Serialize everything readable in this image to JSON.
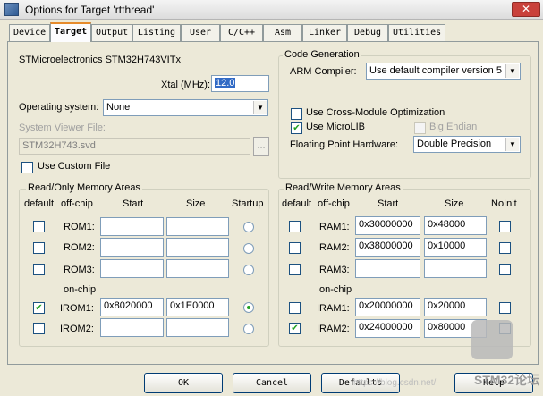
{
  "window": {
    "title": "Options for Target 'rtthread'",
    "close_label": "✕"
  },
  "tabs": [
    {
      "label": "Device"
    },
    {
      "label": "Target"
    },
    {
      "label": "Output"
    },
    {
      "label": "Listing"
    },
    {
      "label": "User"
    },
    {
      "label": "C/C++"
    },
    {
      "label": "Asm"
    },
    {
      "label": "Linker"
    },
    {
      "label": "Debug"
    },
    {
      "label": "Utilities"
    }
  ],
  "active_tab": "Target",
  "device": {
    "name": "STMicroelectronics STM32H743VITx",
    "xtal_label": "Xtal (MHz):",
    "xtal_value": "12.0"
  },
  "os": {
    "label": "Operating system:",
    "value": "None"
  },
  "svd": {
    "label": "System Viewer File:",
    "value": "STM32H743.svd",
    "browse": "..."
  },
  "custom_file": {
    "label": "Use Custom File",
    "checked": false
  },
  "code_gen": {
    "legend": "Code Generation",
    "compiler_label": "ARM Compiler:",
    "compiler_value": "Use default compiler version 5",
    "cross_module": {
      "label": "Use Cross-Module Optimization",
      "checked": false
    },
    "microlib": {
      "label": "Use MicroLIB",
      "checked": true
    },
    "big_endian": {
      "label": "Big Endian",
      "checked": false,
      "enabled": false
    },
    "fpu_label": "Floating Point Hardware:",
    "fpu_value": "Double Precision"
  },
  "ro_memory": {
    "legend": "Read/Only Memory Areas",
    "headers": {
      "default": "default",
      "offchip": "off-chip",
      "start": "Start",
      "size": "Size",
      "startup": "Startup"
    },
    "onchip_label": "on-chip",
    "rows": [
      {
        "name": "ROM1:",
        "default": false,
        "start": "",
        "size": "",
        "startup": false
      },
      {
        "name": "ROM2:",
        "default": false,
        "start": "",
        "size": "",
        "startup": false
      },
      {
        "name": "ROM3:",
        "default": false,
        "start": "",
        "size": "",
        "startup": false
      },
      {
        "name": "IROM1:",
        "default": true,
        "start": "0x8020000",
        "size": "0x1E0000",
        "startup": true
      },
      {
        "name": "IROM2:",
        "default": false,
        "start": "",
        "size": "",
        "startup": false
      }
    ]
  },
  "rw_memory": {
    "legend": "Read/Write Memory Areas",
    "headers": {
      "default": "default",
      "offchip": "off-chip",
      "start": "Start",
      "size": "Size",
      "noinit": "NoInit"
    },
    "onchip_label": "on-chip",
    "rows": [
      {
        "name": "RAM1:",
        "default": false,
        "start": "0x30000000",
        "size": "0x48000",
        "noinit": false
      },
      {
        "name": "RAM2:",
        "default": false,
        "start": "0x38000000",
        "size": "0x10000",
        "noinit": false
      },
      {
        "name": "RAM3:",
        "default": false,
        "start": "",
        "size": "",
        "noinit": false
      },
      {
        "name": "IRAM1:",
        "default": false,
        "start": "0x20000000",
        "size": "0x20000",
        "noinit": false
      },
      {
        "name": "IRAM2:",
        "default": true,
        "start": "0x24000000",
        "size": "0x80000",
        "noinit": false
      }
    ]
  },
  "buttons": {
    "ok": "OK",
    "cancel": "Cancel",
    "defaults": "Defaults",
    "help": "Help"
  },
  "watermark": "https://blog.csdn.net/",
  "logo_text": "STM32论坛",
  "colors": {
    "check_mark": "#21a121",
    "selection": "#316ac5",
    "tab_highlight": "#e68b2c"
  }
}
